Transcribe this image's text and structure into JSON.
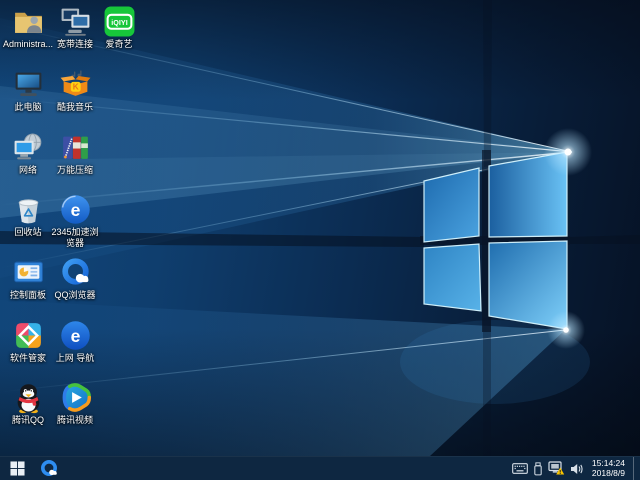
{
  "desktop": {
    "icons": [
      {
        "label": "Administra..."
      },
      {
        "label": "宽带连接"
      },
      {
        "label": "爱奇艺",
        "text": "iQIYI"
      },
      {
        "label": "此电脑"
      },
      {
        "label": "酷我音乐",
        "text": "K"
      },
      {
        "label": "网络"
      },
      {
        "label": "万能压缩"
      },
      {
        "label": "回收站"
      },
      {
        "label": "2345加速浏览器",
        "text": "e"
      },
      {
        "label": "控制面板"
      },
      {
        "label": "QQ浏览器"
      },
      {
        "label": "软件管家"
      },
      {
        "label": "上网 导航",
        "text": "e"
      },
      {
        "label": "腾讯QQ"
      },
      {
        "label": "腾讯视频"
      }
    ]
  },
  "taskbar": {
    "clock": {
      "time": "15:14:24",
      "date": "2018/8/9"
    }
  },
  "wallpaper": {
    "base": "#0b2c52",
    "accent": "#55b8ef",
    "taskbar": "#0e2741"
  }
}
